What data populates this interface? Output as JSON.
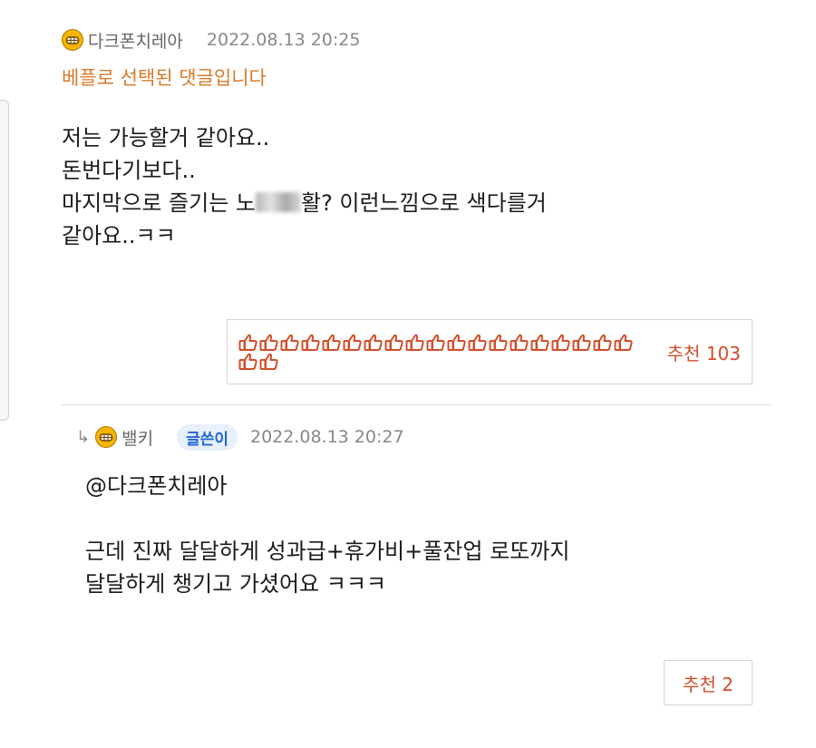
{
  "comment1": {
    "author": "다크폰치레아",
    "date": "2022.08.13 20:25",
    "best_label": "베플로 선택된 댓글입니다",
    "line1": "저는 가능할거 같아요..",
    "line2": "돈번다기보다..",
    "line3_before": "마지막으로 즐기는 노",
    "line3_after": "활? 이런느낌으로 색다를거",
    "line4": "같아요..ㅋㅋ",
    "thumbs_count": 21,
    "recommend_label": "추천 103"
  },
  "comment2": {
    "reply_arrow": "↳",
    "author": "밸키",
    "writer_badge": "글쓴이",
    "date": "2022.08.13 20:27",
    "mention": "@다크폰치레아",
    "line1": "근데 진짜 달달하게 성과급+휴가비+풀잔업 로또까지",
    "line2": "달달하게 챙기고 가셨어요 ㅋㅋㅋ",
    "recommend_label": "추천 2"
  },
  "colors": {
    "best_label": "#d97a2a",
    "recommend": "#d24d2a",
    "badge_text": "#1f66d4",
    "badge_bg": "#e7f0fb",
    "avatar": "#f4b400"
  },
  "icons": {
    "avatar": "grinning-face-icon",
    "thumb": "thumbs-up-icon",
    "reply": "reply-arrow-icon"
  }
}
